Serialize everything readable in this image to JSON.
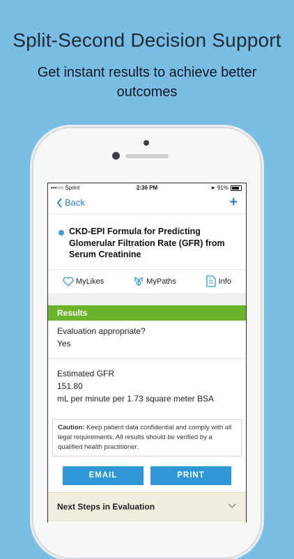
{
  "headline": "Split-Second Decision Support",
  "subheadline": "Get instant results to achieve better outcomes",
  "status_bar": {
    "carrier": "•••○○ Sprint",
    "time": "2:36 PM",
    "battery": "91%"
  },
  "nav": {
    "back_label": "Back",
    "add_label": "+"
  },
  "calculator": {
    "title": "CKD-EPI Formula for Predicting Glomerular Filtration Rate (GFR) from Serum Creatinine"
  },
  "actions": [
    {
      "label": "MyLikes",
      "icon": "heart-icon"
    },
    {
      "label": "MyPaths",
      "icon": "paths-icon"
    },
    {
      "label": "Info",
      "icon": "info-document-icon"
    }
  ],
  "results": {
    "header": "Results",
    "evaluation_label": "Evaluation appropriate?",
    "evaluation_value": "Yes",
    "gfr_label": "Estimated GFR",
    "gfr_value": "151.80",
    "gfr_unit": "mL per minute per 1.73 square meter BSA"
  },
  "caution": {
    "prefix": "Caution:",
    "text": " Keep patient data confidential and comply with all legal requirements. All results should be verified by a qualified health practitioner."
  },
  "buttons": {
    "email": "EMAIL",
    "print": "PRINT"
  },
  "next_steps": {
    "label": "Next Steps in Evaluation"
  },
  "colors": {
    "background": "#79bce4",
    "accent_blue": "#2e97d5",
    "results_green": "#6cb32c",
    "link_blue": "#2f7fd3"
  }
}
